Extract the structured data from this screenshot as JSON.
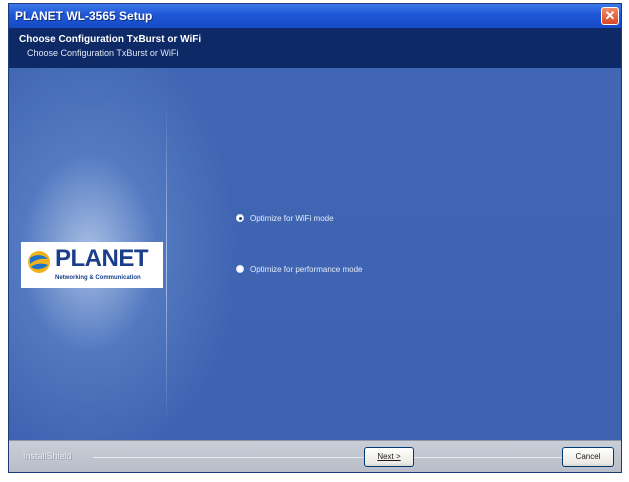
{
  "window": {
    "title": "PLANET WL-3565 Setup",
    "close_glyph": "✕"
  },
  "header": {
    "title": "Choose Configuration TxBurst or WiFi",
    "subtitle": "Choose Configuration TxBurst or WiFi"
  },
  "logo": {
    "word": "PLANET",
    "tagline": "Networking & Communication"
  },
  "options": [
    {
      "label": "Optimize for WiFi mode",
      "checked": true
    },
    {
      "label": "Optimize for performance mode",
      "checked": false
    }
  ],
  "footer": {
    "brand": "InstallShield",
    "next_label": "Next >",
    "cancel_label": "Cancel"
  },
  "colors": {
    "titlebar": "#1f56d6",
    "header": "#0e2a66",
    "content": "#3f64b3",
    "footer": "#c4c8d1"
  }
}
